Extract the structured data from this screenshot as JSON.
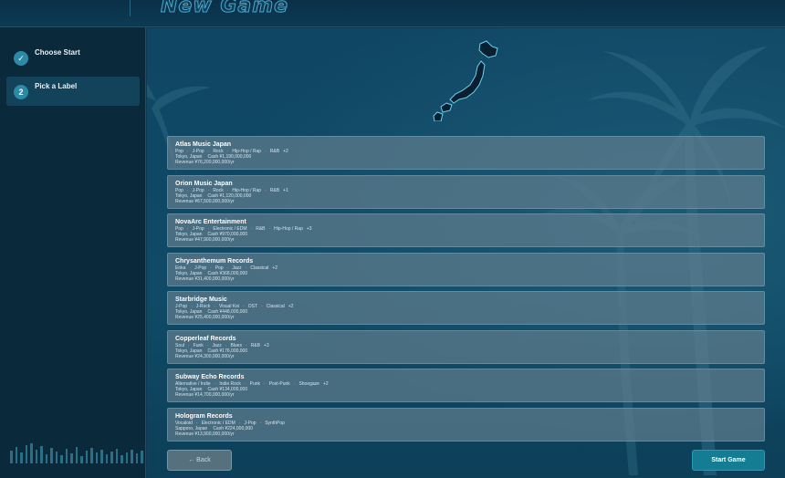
{
  "header": {
    "title": "New Game"
  },
  "steps": [
    {
      "number": "✓",
      "label": "Choose Start",
      "state": "done"
    },
    {
      "number": "2",
      "label": "Pick a Label",
      "state": "active"
    }
  ],
  "labels": [
    {
      "name": "Atlas Music Japan",
      "genres": [
        "Pop",
        "J-Pop",
        "Rock",
        "Hip-Hop / Rap",
        "R&B"
      ],
      "more": "+2",
      "location": "Tokyo, Japan",
      "cash": "Cash ¥1,190,000,000",
      "revenue": "Revenue ¥76,200,000,000/yr"
    },
    {
      "name": "Orion Music Japan",
      "genres": [
        "Pop",
        "J-Pop",
        "Rock",
        "Hip-Hop / Rap",
        "R&B"
      ],
      "more": "+1",
      "location": "Tokyo, Japan",
      "cash": "Cash ¥1,120,000,000",
      "revenue": "Revenue ¥67,500,000,000/yr"
    },
    {
      "name": "NovaArc Entertainment",
      "genres": [
        "Pop",
        "J-Pop",
        "Electronic / EDM",
        "R&B",
        "Hip-Hop / Rap"
      ],
      "more": "+3",
      "location": "Tokyo, Japan",
      "cash": "Cash ¥970,000,000",
      "revenue": "Revenue ¥47,900,000,000/yr"
    },
    {
      "name": "Chrysanthemum Records",
      "genres": [
        "Enka",
        "J-Pop",
        "Pop",
        "Jazz",
        "Classical"
      ],
      "more": "+2",
      "location": "Tokyo, Japan",
      "cash": "Cash ¥368,000,000",
      "revenue": "Revenue ¥31,400,000,000/yr"
    },
    {
      "name": "Starbridge Music",
      "genres": [
        "J-Pop",
        "J-Rock",
        "Visual Kei",
        "OST",
        "Classical"
      ],
      "more": "+2",
      "location": "Tokyo, Japan",
      "cash": "Cash ¥448,000,000",
      "revenue": "Revenue ¥25,400,000,000/yr"
    },
    {
      "name": "Copperleaf Records",
      "genres": [
        "Soul",
        "Funk",
        "Jazz",
        "Blues",
        "R&B"
      ],
      "more": "+3",
      "location": "Tokyo, Japan",
      "cash": "Cash ¥176,000,000",
      "revenue": "Revenue ¥24,300,000,000/yr"
    },
    {
      "name": "Subway Echo Records",
      "genres": [
        "Alternative / Indie",
        "Indie Rock",
        "Punk",
        "Post-Punk",
        "Shoegaze"
      ],
      "more": "+2",
      "location": "Tokyo, Japan",
      "cash": "Cash ¥134,000,000",
      "revenue": "Revenue ¥14,700,000,000/yr"
    },
    {
      "name": "Hologram Records",
      "genres": [
        "Vocaloid",
        "Electronic / EDM",
        "J-Pop",
        "SynthPop"
      ],
      "more": "",
      "location": "Sapporo, Japan",
      "cash": "Cash ¥224,000,000",
      "revenue": "Revenue ¥13,900,000,000/yr"
    }
  ],
  "footer": {
    "back_label": "← Back",
    "start_label": "Start Game"
  },
  "colors": {
    "accent": "#157d93",
    "sidebar": "#0a2a3c",
    "card": "#5f7d8e"
  }
}
